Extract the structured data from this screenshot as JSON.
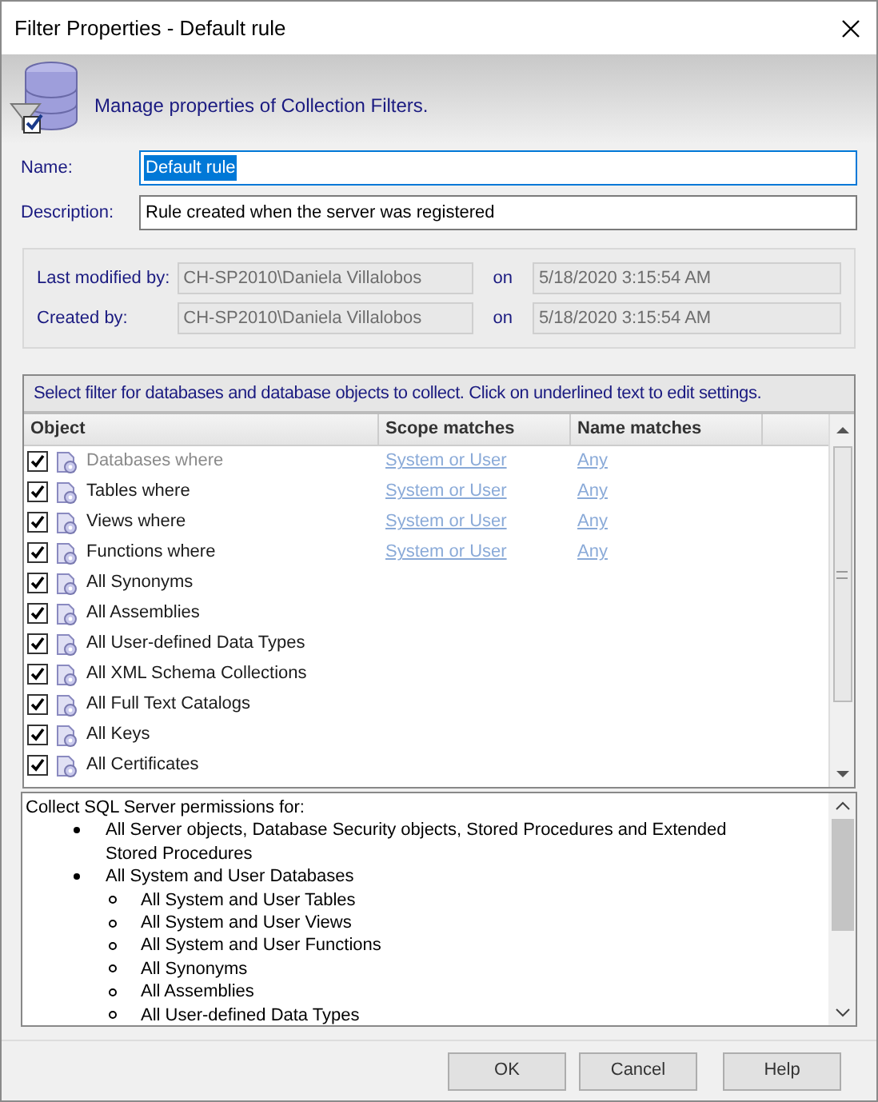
{
  "window": {
    "title": "Filter Properties - Default rule"
  },
  "header": {
    "text": "Manage properties of Collection Filters."
  },
  "fields": [
    {
      "label": "Name:",
      "value": "Default rule",
      "focused": true
    },
    {
      "label": "Description:",
      "value": "Rule created when the server was registered",
      "focused": false
    }
  ],
  "audit": [
    {
      "label": "Last modified by:",
      "user": "CH-SP2010\\Daniela Villalobos",
      "on": "on",
      "date": "5/18/2020 3:15:54 AM"
    },
    {
      "label": "Created by:",
      "user": "CH-SP2010\\Daniela Villalobos",
      "on": "on",
      "date": "5/18/2020 3:15:54 AM"
    }
  ],
  "filter": {
    "instruction": "Select filter for databases and database objects to collect. Click on underlined text to edit settings.",
    "columns": [
      "Object",
      "Scope matches",
      "Name matches"
    ],
    "rows": [
      {
        "object": "Databases where",
        "checked": true,
        "disabled": true,
        "scope": "System or User",
        "name": "Any"
      },
      {
        "object": "Tables where",
        "checked": true,
        "disabled": false,
        "scope": "System or User",
        "name": "Any"
      },
      {
        "object": "Views where",
        "checked": true,
        "disabled": false,
        "scope": "System or User",
        "name": "Any"
      },
      {
        "object": "Functions where",
        "checked": true,
        "disabled": false,
        "scope": "System or User",
        "name": "Any"
      },
      {
        "object": "All Synonyms",
        "checked": true,
        "disabled": false
      },
      {
        "object": "All Assemblies",
        "checked": true,
        "disabled": false
      },
      {
        "object": "All User-defined Data Types",
        "checked": true,
        "disabled": false
      },
      {
        "object": "All XML Schema Collections",
        "checked": true,
        "disabled": false
      },
      {
        "object": "All Full Text Catalogs",
        "checked": true,
        "disabled": false
      },
      {
        "object": "All Keys",
        "checked": true,
        "disabled": false
      },
      {
        "object": "All Certificates",
        "checked": true,
        "disabled": false
      }
    ]
  },
  "permissions": {
    "intro": "Collect SQL Server permissions for:",
    "items": [
      {
        "text": "All Server objects, Database Security objects, Stored Procedures and Extended Stored Procedures"
      },
      {
        "text": "All System and User Databases",
        "children": [
          {
            "text": "All System and User Tables"
          },
          {
            "text": "All System and User Views"
          },
          {
            "text": "All System and User Functions"
          },
          {
            "text": "All Synonyms"
          },
          {
            "text": "All Assemblies"
          },
          {
            "text": "All User-defined Data Types"
          }
        ]
      }
    ]
  },
  "buttons": [
    "OK",
    "Cancel",
    "Help"
  ]
}
